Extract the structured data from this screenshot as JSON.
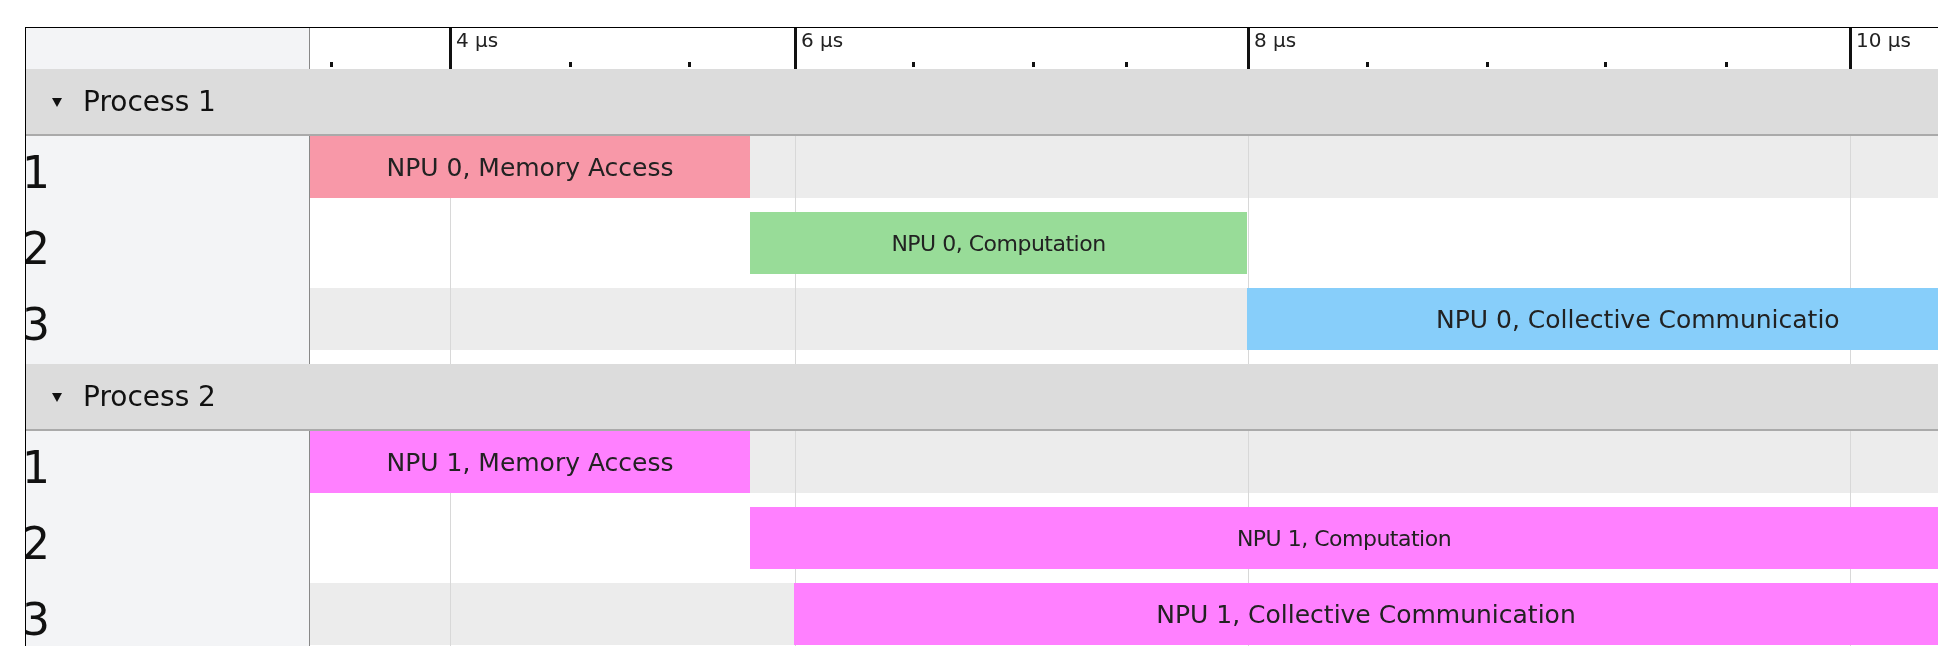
{
  "ruler": {
    "ticks": [
      "4 µs",
      "6 µs",
      "8 µs",
      "10 µs"
    ]
  },
  "processes": [
    {
      "name": "Process 1",
      "expanded": true,
      "threads": [
        {
          "label": "1",
          "bars": [
            {
              "label": "NPU 0, Memory Access",
              "color": "#f898a8"
            }
          ]
        },
        {
          "label": "2",
          "bars": [
            {
              "label": "NPU 0, Computation",
              "color": "#98dc98"
            }
          ]
        },
        {
          "label": "3",
          "bars": [
            {
              "label": "NPU 0, Collective Communicatio",
              "color": "#87cefa"
            }
          ]
        }
      ]
    },
    {
      "name": "Process 2",
      "expanded": true,
      "threads": [
        {
          "label": "1",
          "bars": [
            {
              "label": "NPU 1, Memory Access",
              "color": "#ff80ff"
            }
          ]
        },
        {
          "label": "2",
          "bars": [
            {
              "label": "NPU 1, Computation",
              "color": "#ff80ff"
            }
          ]
        },
        {
          "label": "3",
          "bars": [
            {
              "label": "NPU 1, Collective Communication",
              "color": "#ff80ff"
            }
          ]
        }
      ]
    }
  ]
}
